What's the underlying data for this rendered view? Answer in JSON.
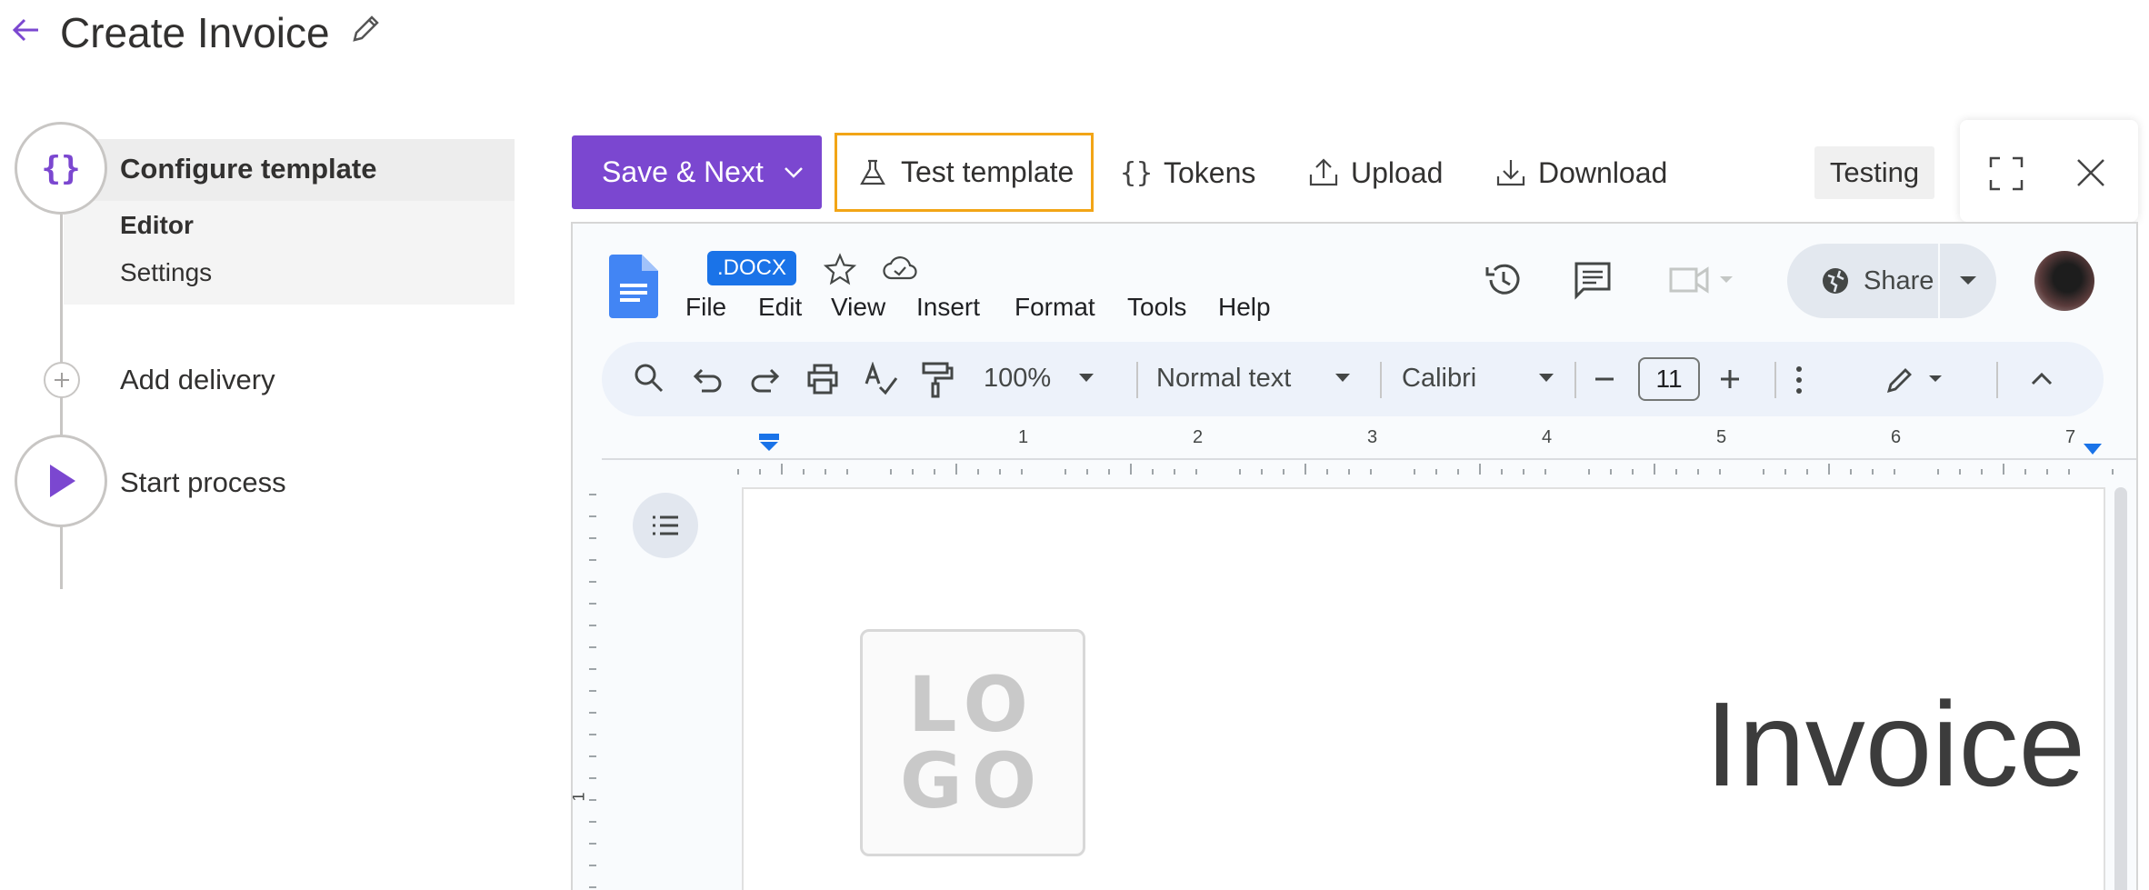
{
  "header": {
    "title": "Create Invoice"
  },
  "stepper": {
    "step1": {
      "label": "Configure template",
      "sub_items": [
        "Editor",
        "Settings"
      ]
    },
    "step2": {
      "label": "Add delivery"
    },
    "step3": {
      "label": "Start process"
    }
  },
  "toolbar": {
    "save_label": "Save & Next",
    "test_label": "Test template",
    "tokens_label": "Tokens",
    "upload_label": "Upload",
    "download_label": "Download",
    "status_badge": "Testing"
  },
  "doc": {
    "badge": ".DOCX",
    "menu": [
      "File",
      "Edit",
      "View",
      "Insert",
      "Format",
      "Tools",
      "Help"
    ],
    "share_label": "Share",
    "zoom": "100%",
    "style": "Normal text",
    "font": "Calibri",
    "font_size": "11",
    "ruler_numbers": [
      "1",
      "2",
      "3",
      "4",
      "5",
      "6",
      "7"
    ],
    "vruler_number": "1",
    "logo_lines": [
      "LO",
      "GO"
    ],
    "page_title": "Invoice"
  },
  "colors": {
    "accent": "#7b47d0",
    "highlight": "#f2a516",
    "docs_blue": "#1a73e8"
  }
}
